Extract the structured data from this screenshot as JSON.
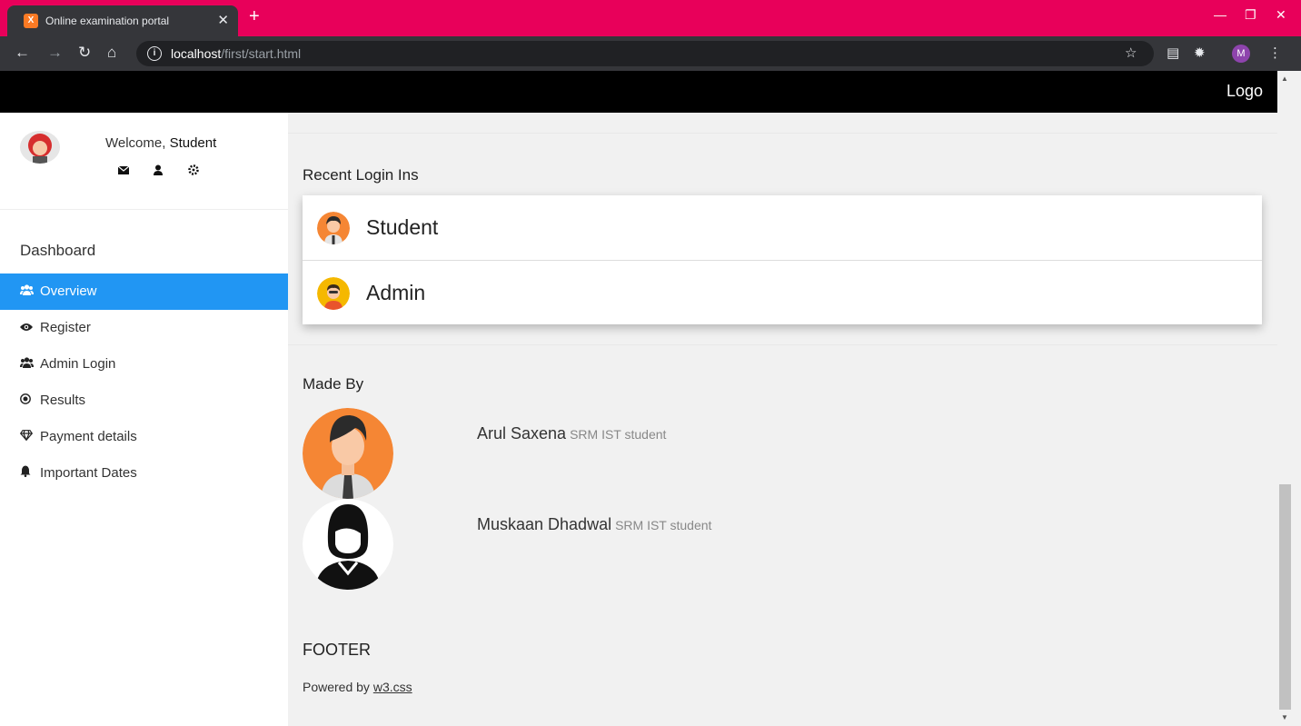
{
  "browser": {
    "tab_title": "Online examination portal",
    "favicon_glyph": "X",
    "new_tab": "+",
    "url_host": "localhost",
    "url_path": "/first/start.html",
    "profile_initial": "M",
    "accent_color": "#e8005a"
  },
  "topbar": {
    "logo": "Logo"
  },
  "sidebar": {
    "welcome_prefix": "Welcome, ",
    "welcome_name": "Student",
    "heading": "Dashboard",
    "items": [
      {
        "label": "Overview",
        "icon": "users-icon",
        "active": true
      },
      {
        "label": "Register",
        "icon": "eye-icon"
      },
      {
        "label": "Admin Login",
        "icon": "users-icon"
      },
      {
        "label": "Results",
        "icon": "bullseye-icon"
      },
      {
        "label": "Payment details",
        "icon": "diamond-icon"
      },
      {
        "label": "Important Dates",
        "icon": "bell-icon"
      }
    ],
    "active_color": "#2196f3"
  },
  "recent_logins": {
    "title": "Recent Login Ins",
    "items": [
      "Student",
      "Admin"
    ]
  },
  "made_by": {
    "title": "Made By",
    "people": [
      {
        "name": "Arul Saxena",
        "role": "SRM IST student"
      },
      {
        "name": "Muskaan Dhadwal",
        "role": "SRM IST student"
      }
    ]
  },
  "footer": {
    "title": "FOOTER",
    "powered_prefix": "Powered by ",
    "powered_link": "w3.css"
  }
}
